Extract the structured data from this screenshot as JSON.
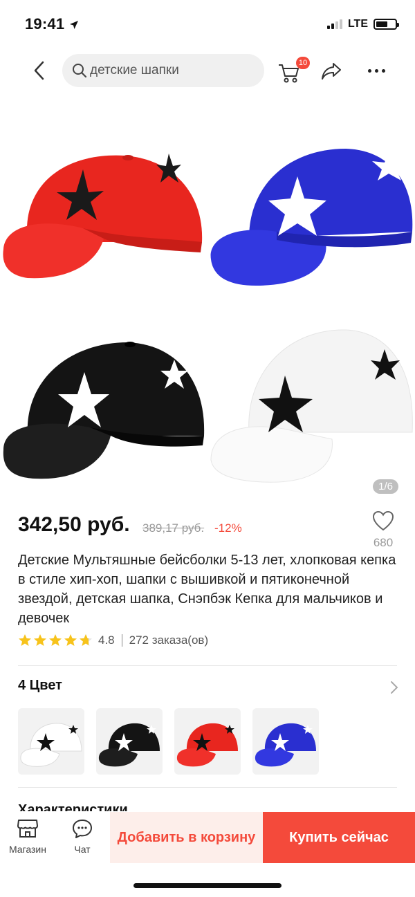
{
  "status_bar": {
    "time": "19:41",
    "network": "LTE"
  },
  "header": {
    "search_text": "детские шапки",
    "cart_badge": "10"
  },
  "gallery": {
    "counter": "1/6"
  },
  "product": {
    "price": "342,50 руб.",
    "old_price": "389,17 руб.",
    "discount": "-12%",
    "wishlist_count": "680",
    "title": "Детские Мультяшные бейсболки 5-13 лет, хлопковая кепка в стиле хип-хоп, шапки с вышивкой и пятиконечной звездой, детская шапка, Снэпбэк Кепка для мальчиков и девочек",
    "rating": "4.8",
    "rating_fraction": 0.96,
    "orders": "272 заказа(ов)"
  },
  "colors": {
    "title": "4 Цвет",
    "swatches": [
      "white-black-star",
      "black-white-star",
      "red-black-star",
      "blue-white-star"
    ]
  },
  "characteristics": {
    "title": "Характеристики"
  },
  "bottom_bar": {
    "store_label": "Магазин",
    "chat_label": "Чат",
    "add_to_cart": "Добавить в корзину",
    "buy_now": "Купить сейчас"
  },
  "colors_palette": {
    "accent": "#f44a3b",
    "cap_red": "#e8261f",
    "cap_blue": "#2a2fd0",
    "cap_black": "#111111",
    "cap_white": "#f4f4f4"
  }
}
